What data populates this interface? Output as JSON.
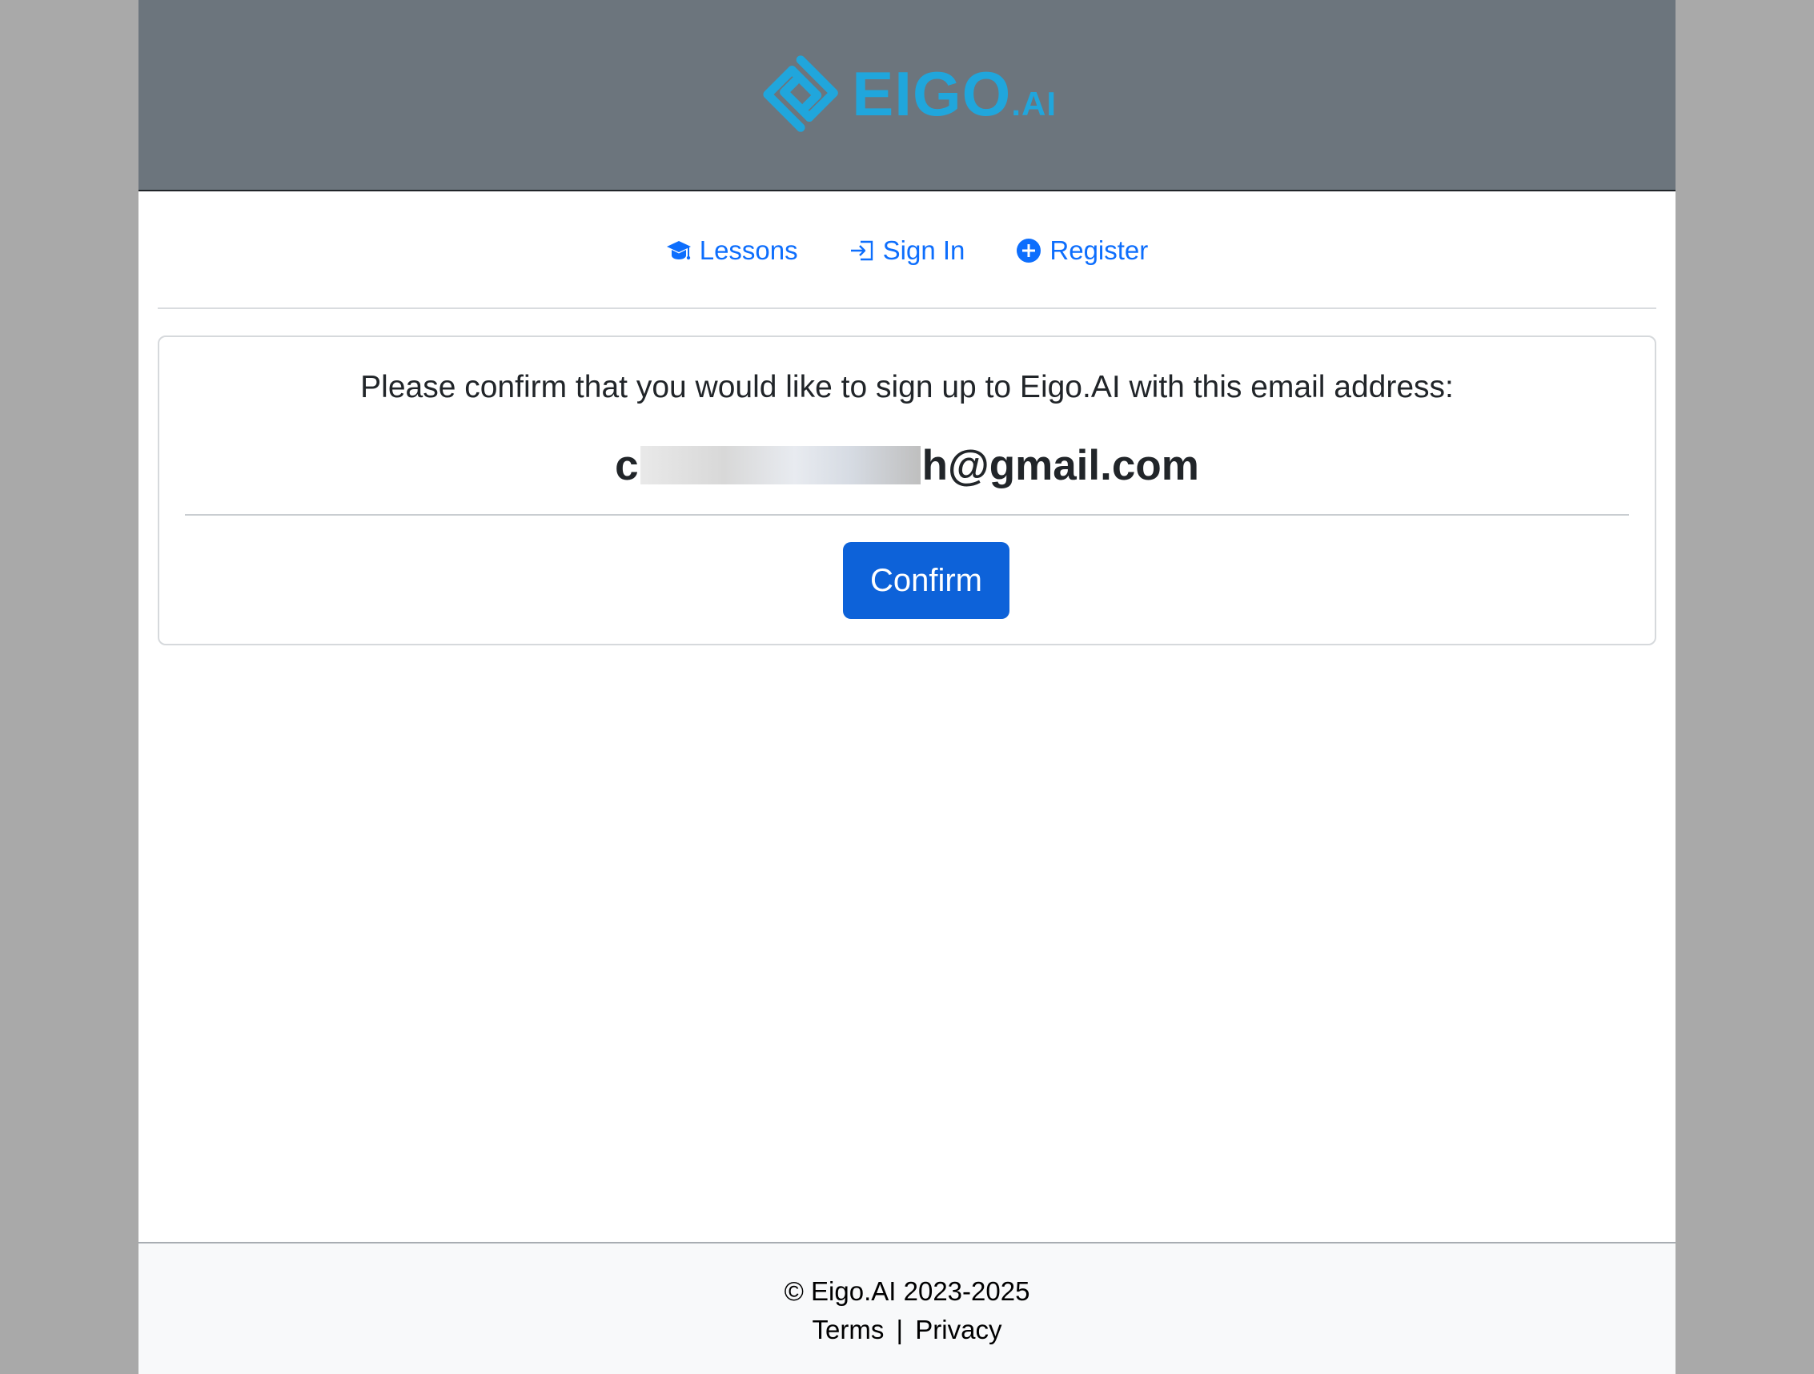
{
  "brand": {
    "logo_main": "EIGO",
    "logo_suffix": ".AI",
    "logo_icon": "eigo-diamond-logo",
    "logo_color": "#20a6dc"
  },
  "nav": {
    "items": [
      {
        "label": "Lessons",
        "icon": "graduation-cap-icon"
      },
      {
        "label": "Sign In",
        "icon": "sign-in-icon"
      },
      {
        "label": "Register",
        "icon": "plus-circle-icon"
      }
    ],
    "link_color": "#0d6efd"
  },
  "confirmation": {
    "prompt": "Please confirm that you would like to sign up to Eigo.AI with this email address:",
    "email_visible_start": "c",
    "email_visible_end": "h@gmail.com",
    "email_redacted": true,
    "button_label": "Confirm",
    "button_color": "#0d62d9"
  },
  "footer": {
    "copyright": "© Eigo.AI 2023-2025",
    "terms_label": "Terms",
    "separator": "|",
    "privacy_label": "Privacy"
  }
}
